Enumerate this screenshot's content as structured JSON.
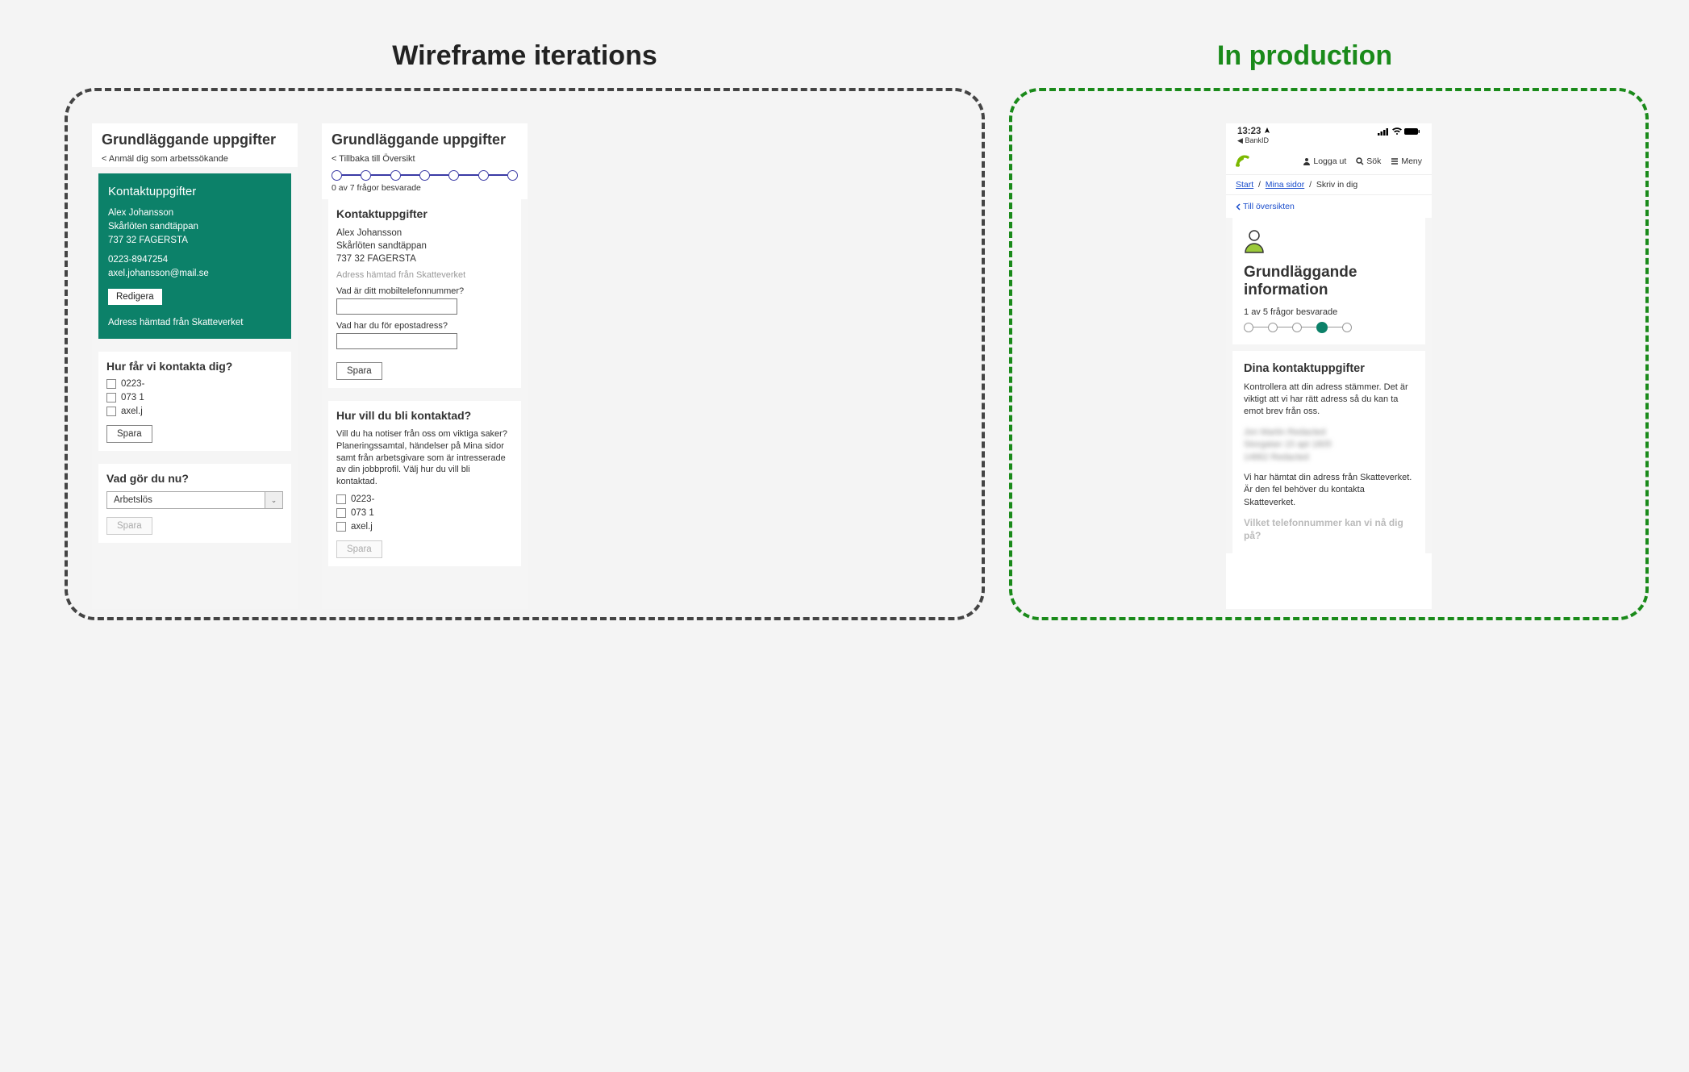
{
  "headings": {
    "wireframes": "Wireframe iterations",
    "production": "In production"
  },
  "wf1": {
    "title": "Grundläggande uppgifter",
    "back": "< Anmäl dig som arbetssökande",
    "contact_card": {
      "title": "Kontaktuppgifter",
      "name": "Alex Johansson",
      "street": "Skårlöten sandtäppan",
      "postal": "737 32 FAGERSTA",
      "phone": "0223-8947254",
      "email": "axel.johansson@mail.se",
      "edit_btn": "Redigera",
      "note": "Adress hämtad från Skatteverket"
    },
    "contact_pref": {
      "title": "Hur får vi kontakta dig?",
      "opt1": "0223-",
      "opt2": "073 1",
      "opt3": "axel.j",
      "save": "Spara"
    },
    "status": {
      "title": "Vad gör du nu?",
      "selected": "Arbetslös",
      "save": "Spara"
    }
  },
  "wf2": {
    "title": "Grundläggande uppgifter",
    "back": "< Tillbaka till Översikt",
    "progress_caption": "0 av 7 frågor besvarade",
    "contact": {
      "title": "Kontaktuppgifter",
      "name": "Alex Johansson",
      "street": "Skårlöten sandtäppan",
      "postal": "737 32 FAGERSTA",
      "note": "Adress hämtad från Skatteverket",
      "q_phone": "Vad är ditt mobiltelefonnummer?",
      "q_email": "Vad har du för epostadress?",
      "save": "Spara"
    },
    "contact_pref": {
      "title": "Hur vill du bli kontaktad?",
      "intro": "Vill du ha notiser från oss om viktiga saker? Planeringssamtal, händelser på Mina sidor samt från arbetsgivare som är intresserade av din jobbprofil. Välj hur du vill bli kontaktad.",
      "opt1": "0223-",
      "opt2": "073 1",
      "opt3": "axel.j",
      "save": "Spara"
    }
  },
  "prod": {
    "status_time": "13:23",
    "status_app": "BankID",
    "logout": "Logga ut",
    "search": "Sök",
    "menu": "Meny",
    "crumb1": "Start",
    "crumb2": "Mina sidor",
    "crumb3": "Skriv in dig",
    "back": "Till översikten",
    "title": "Grundläggande information",
    "progress": "1 av 5 frågor besvarade",
    "contact_title": "Dina kontaktuppgifter",
    "contact_para": "Kontrollera att din adress stämmer. Det är viktigt att vi har rätt adress så du kan ta emot brev från oss.",
    "blur1": "Jon Martin Redacted",
    "blur2": "Storgatan 15 apt 1805",
    "blur3": "14862 Redacted",
    "contact_para2": "Vi har hämtat din adress från Skatteverket. Är den fel behöver du kontakta Skatteverket.",
    "fade_q": "Vilket telefonnummer kan vi nå dig på?"
  }
}
